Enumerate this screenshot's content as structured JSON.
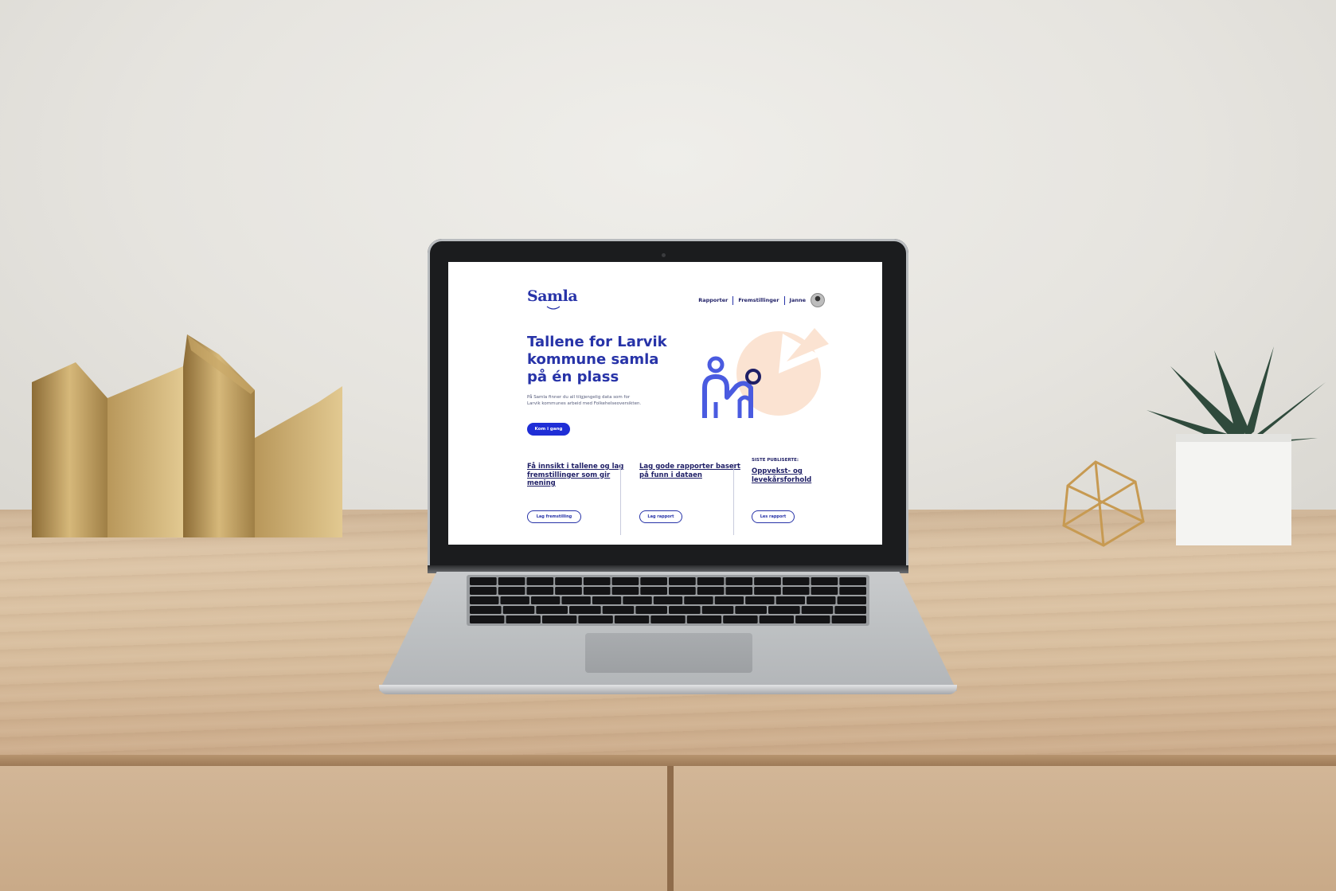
{
  "site": {
    "logo": "Samla",
    "nav": {
      "item1": "Rapporter",
      "item2": "Fremstillinger",
      "user": "Janne"
    },
    "hero": {
      "title": "Tallene for Larvik kommune samla på én plass",
      "subtitle": "På Samla finner du all tilgjengelig data som for Larvik kommunes arbeid med Folkehelseoversikten.",
      "cta": "Kom i gang"
    },
    "columns": [
      {
        "heading": "Få innsikt i tallene og lag fremstillinger som gir mening",
        "button": "Lag fremstilling"
      },
      {
        "heading": "Lag gode rapporter basert på funn i dataen",
        "button": "Lag rapport"
      },
      {
        "kicker": "SISTE PUBLISERTE:",
        "heading": "Oppvekst- og levekårsforhold",
        "button": "Les rapport"
      }
    ]
  },
  "colors": {
    "brand": "#2733a8",
    "cta": "#1f2ed6",
    "text": "#1f1f66",
    "illustration_peach": "#fbe3d2"
  },
  "icons": [
    "user-avatar-icon",
    "people-pie-illustration"
  ]
}
